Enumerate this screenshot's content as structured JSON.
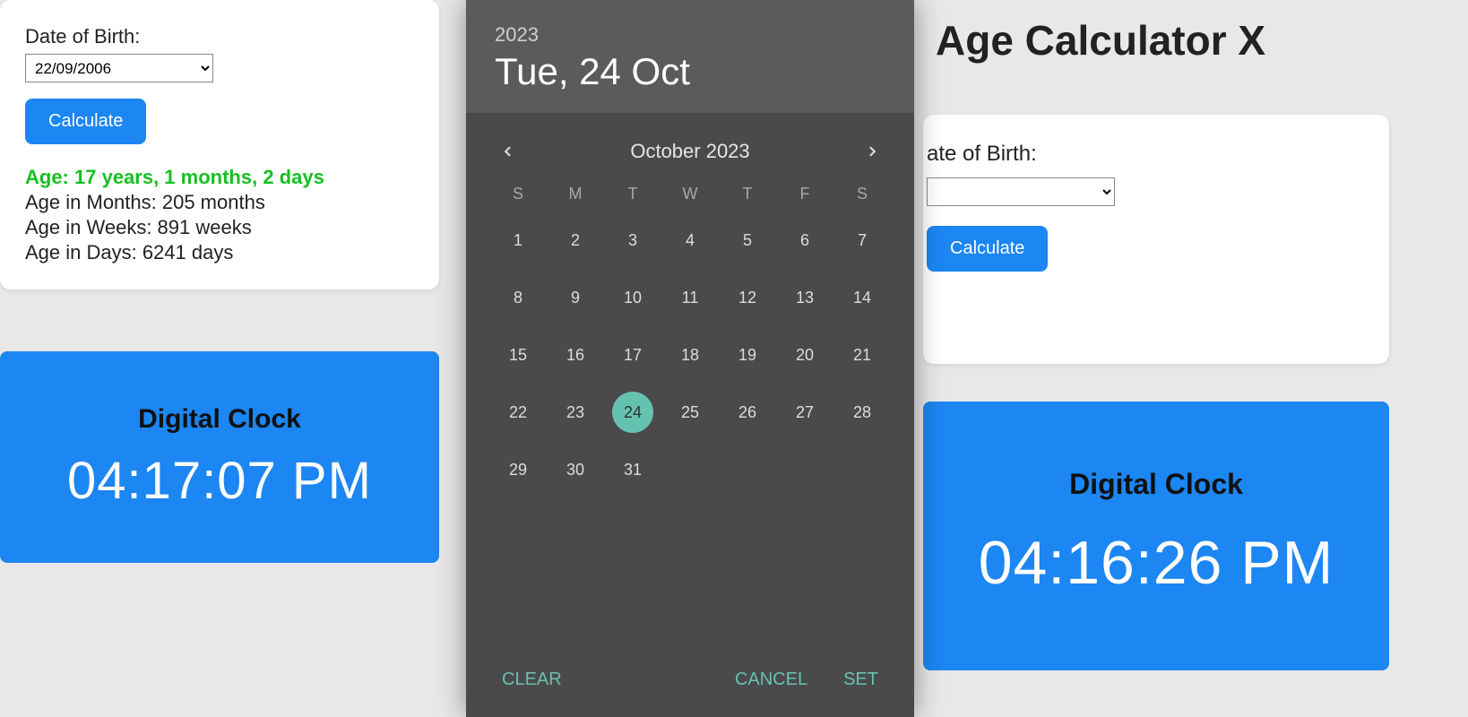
{
  "left": {
    "dob_label": "Date of Birth:",
    "dob_value": "22/09/2006",
    "calc_label": "Calculate",
    "age_line": "Age: 17 years, 1 months, 2 days",
    "months_line": "Age in Months: 205 months",
    "weeks_line": "Age in Weeks: 891 weeks",
    "days_line": "Age in Days: 6241 days",
    "clock_title": "Digital Clock",
    "clock_time": "04:17:07 PM"
  },
  "right": {
    "app_title": "Age Calculator X",
    "dob_label": "ate of Birth:",
    "dob_value": "",
    "calc_label": "Calculate",
    "clock_title": "Digital Clock",
    "clock_time": "04:16:26 PM"
  },
  "picker": {
    "year": "2023",
    "day_long": "Tue, 24 Oct",
    "month_label": "October 2023",
    "dow": [
      "S",
      "M",
      "T",
      "W",
      "T",
      "F",
      "S"
    ],
    "blanks": 0,
    "days": [
      1,
      2,
      3,
      4,
      5,
      6,
      7,
      8,
      9,
      10,
      11,
      12,
      13,
      14,
      15,
      16,
      17,
      18,
      19,
      20,
      21,
      22,
      23,
      24,
      25,
      26,
      27,
      28,
      29,
      30,
      31
    ],
    "selected": 24,
    "clear": "CLEAR",
    "cancel": "CANCEL",
    "set": "SET"
  }
}
